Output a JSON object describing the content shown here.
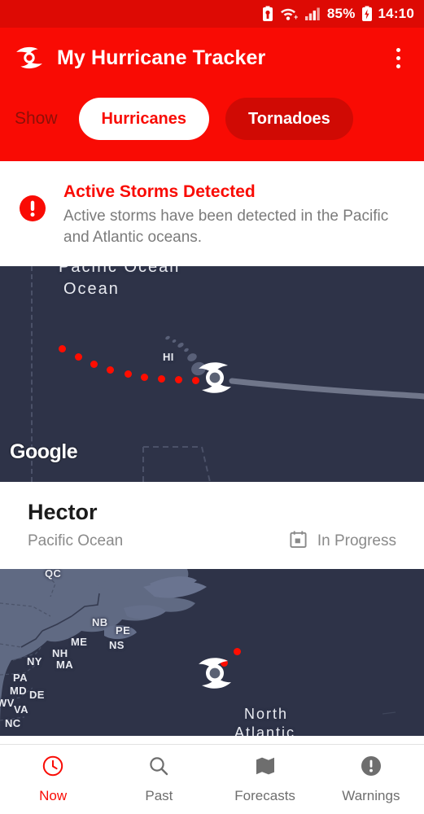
{
  "status_bar": {
    "battery_percent": "85%",
    "time": "14:10",
    "icons": [
      "battery-saver-icon",
      "wifi-icon",
      "cellular-signal-icon",
      "battery-charging-icon"
    ]
  },
  "app_bar": {
    "logo_icon": "hurricane-logo-icon",
    "title": "My Hurricane Tracker",
    "overflow_icon": "overflow-menu-icon"
  },
  "filter": {
    "label": "Show",
    "chips": [
      {
        "label": "Hurricanes",
        "selected": true
      },
      {
        "label": "Tornadoes",
        "selected": false
      }
    ]
  },
  "alert": {
    "icon": "error-exclamation-icon",
    "title": "Active Storms Detected",
    "body": "Active storms have been detected in the Pacific and Atlantic oceans."
  },
  "storms": [
    {
      "name": "Hector",
      "region": "Pacific Ocean",
      "status": "In Progress",
      "status_icon": "calendar-icon",
      "map": {
        "attribution": "Google",
        "labels": [
          "Pacific Ocean",
          "HI"
        ],
        "marker_icon": "hurricane-marker-icon",
        "track_points": 9
      }
    }
  ],
  "atlantic_map": {
    "labels": [
      "QC",
      "NB",
      "PE",
      "ME",
      "NS",
      "NH",
      "NY",
      "MA",
      "PA",
      "MD",
      "DE",
      "WV",
      "VA",
      "NC",
      "North",
      "Atlantic"
    ],
    "marker_icon": "hurricane-marker-icon",
    "track_points": 2
  },
  "bottom_nav": [
    {
      "label": "Now",
      "icon": "clock-icon",
      "active": true
    },
    {
      "label": "Past",
      "icon": "search-icon",
      "active": false
    },
    {
      "label": "Forecasts",
      "icon": "map-icon",
      "active": false
    },
    {
      "label": "Warnings",
      "icon": "warning-circle-icon",
      "active": false
    }
  ],
  "colors": {
    "brand_red": "#F90B04",
    "status_bar_red": "#DD0A04",
    "chip_unselected": "#D00A04",
    "ocean": "#2E3348",
    "land": "#606A83",
    "muted_text": "#8A8A8A"
  }
}
